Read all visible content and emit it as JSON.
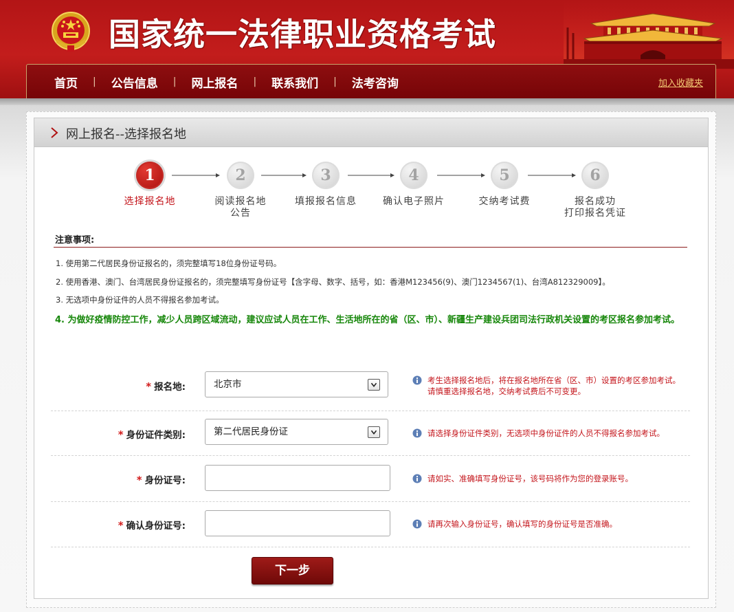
{
  "header": {
    "title": "国家统一法律职业资格考试",
    "emblem_icon": "national-emblem-icon",
    "banner_image": "tiananmen-illustration"
  },
  "nav": {
    "items": [
      {
        "label": "首页"
      },
      {
        "label": "公告信息"
      },
      {
        "label": "网上报名"
      },
      {
        "label": "联系我们"
      },
      {
        "label": "法考咨询"
      }
    ],
    "separator": "|",
    "bookmark_label": "加入收藏夹"
  },
  "panel": {
    "title": "网上报名--选择报名地"
  },
  "steps": [
    {
      "number": "1",
      "label_line1": "选择报名地",
      "label_line2": "",
      "active": true
    },
    {
      "number": "2",
      "label_line1": "阅读报名地",
      "label_line2": "公告",
      "active": false
    },
    {
      "number": "3",
      "label_line1": "填报报名信息",
      "label_line2": "",
      "active": false
    },
    {
      "number": "4",
      "label_line1": "确认电子照片",
      "label_line2": "",
      "active": false
    },
    {
      "number": "5",
      "label_line1": "交纳考试费",
      "label_line2": "",
      "active": false
    },
    {
      "number": "6",
      "label_line1": "报名成功",
      "label_line2": "打印报名凭证",
      "active": false
    }
  ],
  "notice": {
    "title": "注意事项:",
    "items": [
      "1. 使用第二代居民身份证报名的，须完整填写18位身份证号码。",
      "2. 使用香港、澳门、台湾居民身份证报名的，须完整填写身份证号【含字母、数字、括号，如：香港M123456(9)、澳门1234567(1)、台湾A812329009】。",
      "3. 无选项中身份证件的人员不得报名参加考试。"
    ],
    "highlight": "4. 为做好疫情防控工作，减少人员跨区域流动，建议应试人员在工作、生活地所在的省（区、市）、新疆生产建设兵团司法行政机关设置的考区报名参加考试。"
  },
  "form": {
    "required_mark": "*",
    "location": {
      "label": "报名地:",
      "value": "北京市",
      "hint": "考生选择报名地后，将在报名地所在省（区、市）设置的考区参加考试。请慎重选择报名地，交纳考试费后不可变更。"
    },
    "id_type": {
      "label": "身份证件类别:",
      "value": "第二代居民身份证",
      "hint": "请选择身份证件类别，无选项中身份证件的人员不得报名参加考试。"
    },
    "id_number": {
      "label": "身份证号:",
      "value": "",
      "hint": "请如实、准确填写身份证号，该号码将作为您的登录账号。"
    },
    "id_confirm": {
      "label": "确认身份证号:",
      "value": "",
      "hint": "请再次输入身份证号，确认填写的身份证号是否准确。"
    },
    "next_label": "下一步"
  },
  "colors": {
    "brand_red": "#b31516",
    "nav_bg": "#7d0709",
    "hint_red": "#c4161c",
    "notice_green": "#17870b",
    "bookmark_gold": "#f3c873"
  }
}
